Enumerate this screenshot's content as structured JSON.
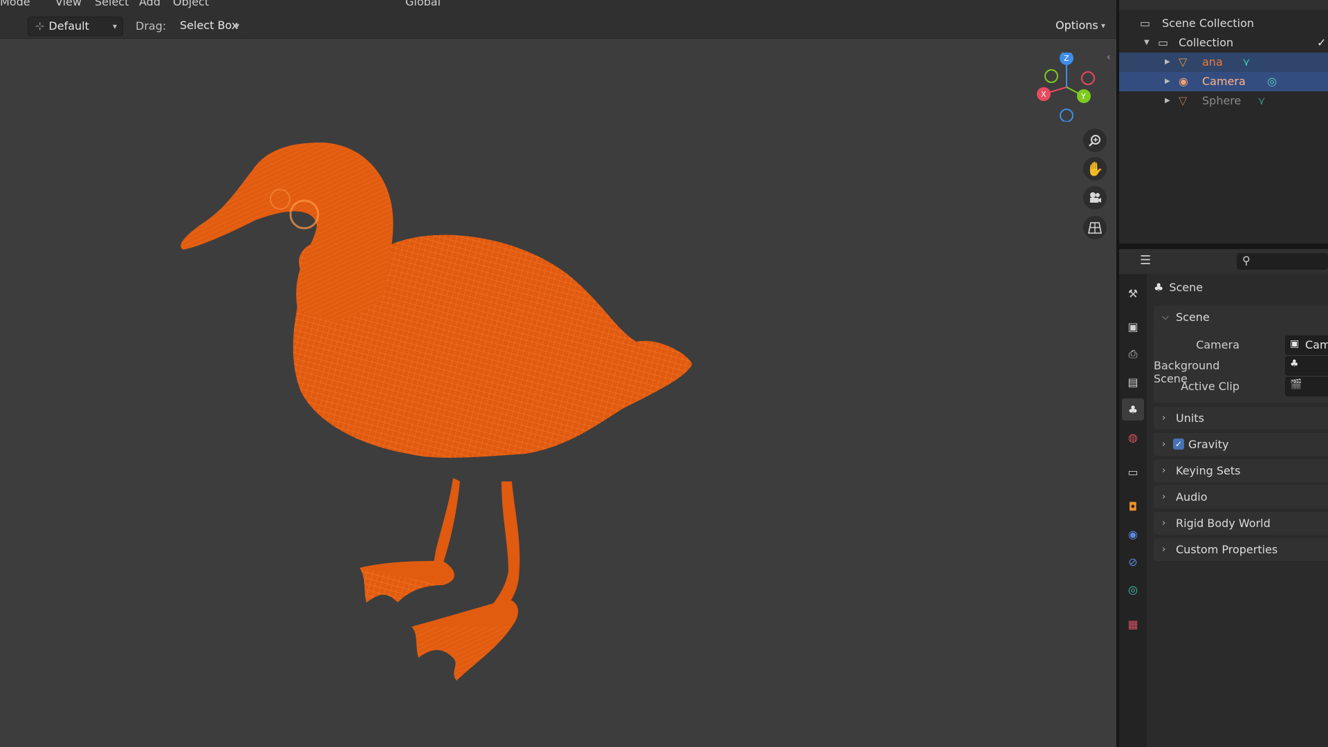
{
  "menubar": {
    "items": [
      "Mode",
      "View",
      "Select",
      "Add",
      "Object"
    ],
    "orientation": "Global"
  },
  "toolbar": {
    "orientation_value": "Default",
    "drag_label": "Drag:",
    "drag_value": "Select Box",
    "options_label": "Options"
  },
  "viewport": {
    "model_color": "#e05a0f",
    "background": "#3d3d3d"
  },
  "gizmo": {
    "x_label": "X",
    "y_label": "Y",
    "z_label": "Z",
    "x_color": "#e84a5f",
    "y_color": "#7ecb20",
    "z_color": "#3f8de8"
  },
  "outliner": {
    "root": "Scene Collection",
    "collection": "Collection",
    "items": [
      {
        "label": "ana",
        "icon": "mesh-icon",
        "state": "selected"
      },
      {
        "label": "Camera",
        "icon": "camera-icon",
        "state": "active"
      },
      {
        "label": "Sphere",
        "icon": "mesh-icon",
        "state": "hidden"
      }
    ]
  },
  "properties": {
    "context_title": "Scene",
    "panel_title": "Scene",
    "fields": {
      "camera_label": "Camera",
      "camera_value": "Cam",
      "background_label": "Background Scene",
      "clip_label": "Active Clip"
    },
    "subpanels": [
      "Units",
      "Gravity",
      "Keying Sets",
      "Audio",
      "Rigid Body World",
      "Custom Properties"
    ],
    "gravity_checked": true
  }
}
